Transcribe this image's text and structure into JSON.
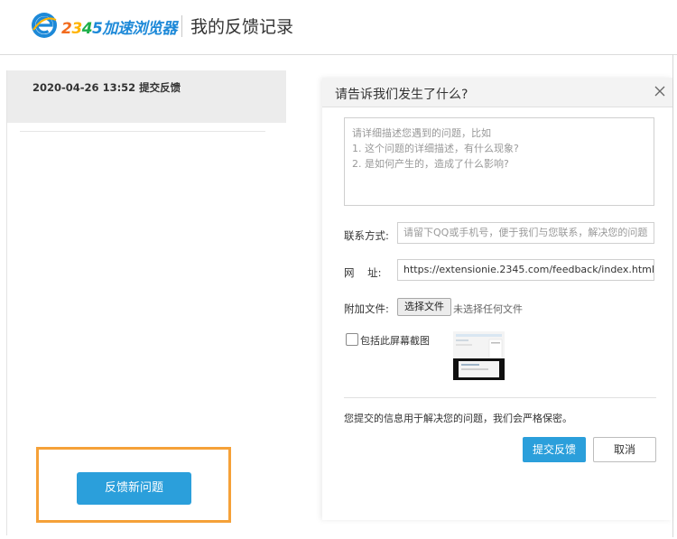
{
  "header": {
    "brand": {
      "n2": "2",
      "n3": "3",
      "n4": "4",
      "n5": "5",
      "name": "加速浏览器"
    },
    "title": "我的反馈记录"
  },
  "records": [
    {
      "text": "2020-04-26 13:52 提交反馈"
    }
  ],
  "left_panel": {
    "new_feedback_button": "反馈新问题"
  },
  "dialog": {
    "title": "请告诉我们发生了什么?",
    "description_placeholder": [
      "请详细描述您遇到的问题，比如",
      "1. 这个问题的详细描述，有什么现象?",
      "2. 是如何产生的，造成了什么影响?"
    ],
    "contact_label": "联系方式:",
    "contact_placeholder": "请留下QQ或手机号，便于我们与您联系，解决您的问题",
    "url_label": "网    址:",
    "url_value": "https://extensionie.2345.com/feedback/index.html",
    "attach_label": "附加文件:",
    "choose_file_button": "选择文件",
    "no_file_text": "未选择任何文件",
    "screenshot_checkbox_label": "包括此屏幕截图",
    "screenshot_checked": false,
    "privacy_note": "您提交的信息用于解决您的问题，我们会严格保密。",
    "submit_button": "提交反馈",
    "cancel_button": "取消"
  },
  "colors": {
    "accent": "#2b9fdb",
    "highlight_frame": "#f5a138",
    "record_bg": "#ececec"
  }
}
